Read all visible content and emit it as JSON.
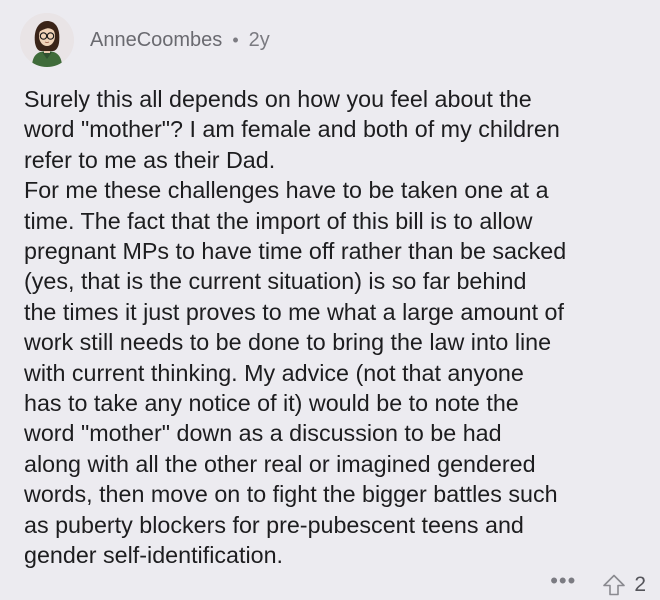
{
  "comment": {
    "author": "AnneCoombes",
    "separator": "•",
    "age": "2y",
    "lines": [
      "Surely this all depends on how you feel about the",
      "word \"mother\"? I am female and both of my children",
      "refer to me as their Dad.",
      "For me these challenges have to be taken one at a",
      "time. The fact that the import of this bill is to allow",
      "pregnant MPs to have time off rather than be sacked",
      "(yes, that is the current situation) is so far behind",
      "the times it just proves to me what a large amount of",
      "work still needs to be done to bring the law into line",
      "with current thinking. My advice (not that anyone",
      "has to take any notice of it) would be to note the",
      "word \"mother\" down as a discussion to be had",
      "along with all the other real or imagined gendered",
      "words, then move on to fight the bigger battles such",
      "as puberty blockers for pre-pubescent teens and",
      "gender self-identification."
    ]
  },
  "actions": {
    "more_label": "•••",
    "upvote_count": "2"
  },
  "icons": {
    "avatar": "avatar-illustration",
    "more": "more-options-icon",
    "upvote": "upvote-arrow-icon"
  },
  "colors": {
    "background": "#ecebf0",
    "text": "#1d1d1f",
    "meta": "#6c6c72",
    "avatar_bg": "#e9e4e6",
    "avatar_shirt": "#3f6b3a"
  }
}
